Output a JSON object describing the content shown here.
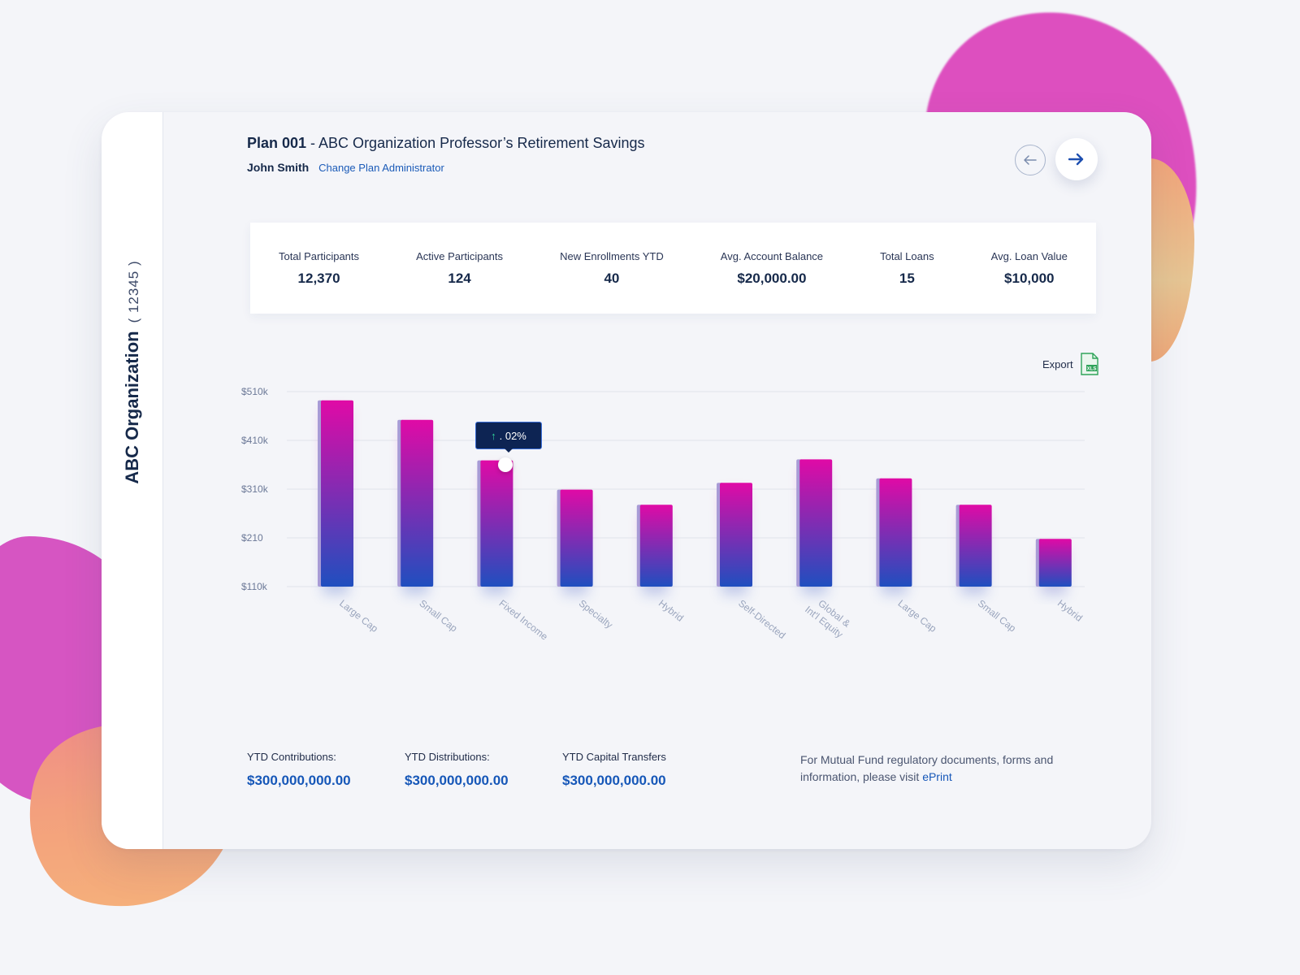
{
  "sidebar": {
    "org_name": "ABC Organization",
    "org_id": "( 12345 )"
  },
  "header": {
    "plan_id": "Plan 001",
    "plan_name": " - ABC Organization Professor’s Retirement Savings",
    "admin_name": "John Smith",
    "change_admin_label": "Change Plan Administrator",
    "nav_prev_icon": "arrow-left-icon",
    "nav_next_icon": "arrow-right-icon"
  },
  "stats": [
    {
      "label": "Total Participants",
      "value": "12,370"
    },
    {
      "label": "Active Participants",
      "value": "124"
    },
    {
      "label": "New Enrollments YTD",
      "value": "40"
    },
    {
      "label": "Avg. Account Balance",
      "value": "$20,000.00"
    },
    {
      "label": "Total Loans",
      "value": "15"
    },
    {
      "label": "Avg. Loan Value",
      "value": "$10,000"
    }
  ],
  "export": {
    "label": "Export",
    "icon": "xls-file-icon"
  },
  "tooltip": {
    "text": ". 02%",
    "icon": "arrow-up-icon"
  },
  "chart_data": {
    "type": "bar",
    "categories": [
      "Large Cap",
      "Small Cap",
      "Fixed Income",
      "Specialty",
      "Hybrid",
      "Self-Directed",
      "Global & Int'l Equity",
      "Large Cap",
      "Small Cap",
      "Hybrid"
    ],
    "values": [
      492,
      452,
      369,
      309,
      278,
      323,
      371,
      332,
      278,
      208
    ],
    "yticks": [
      110,
      210,
      310,
      410,
      510
    ],
    "ytick_labels": [
      "$110k",
      "$210",
      "$310k",
      "$410k",
      "$510k"
    ],
    "ylim": [
      110,
      510
    ],
    "grid": true,
    "colors": {
      "top": "#e00aa6",
      "bottom": "#1f4fbf",
      "shade": "#a89bd6"
    }
  },
  "totals": [
    {
      "label": "YTD Contributions:",
      "value": "$300,000,000.00"
    },
    {
      "label": "YTD Distributions:",
      "value": "$300,000,000.00"
    },
    {
      "label": "YTD Capital Transfers",
      "value": "$300,000,000.00"
    }
  ],
  "notice": {
    "text": "For Mutual Fund regulatory documents, forms and information, please visit ",
    "link": "ePrint"
  }
}
